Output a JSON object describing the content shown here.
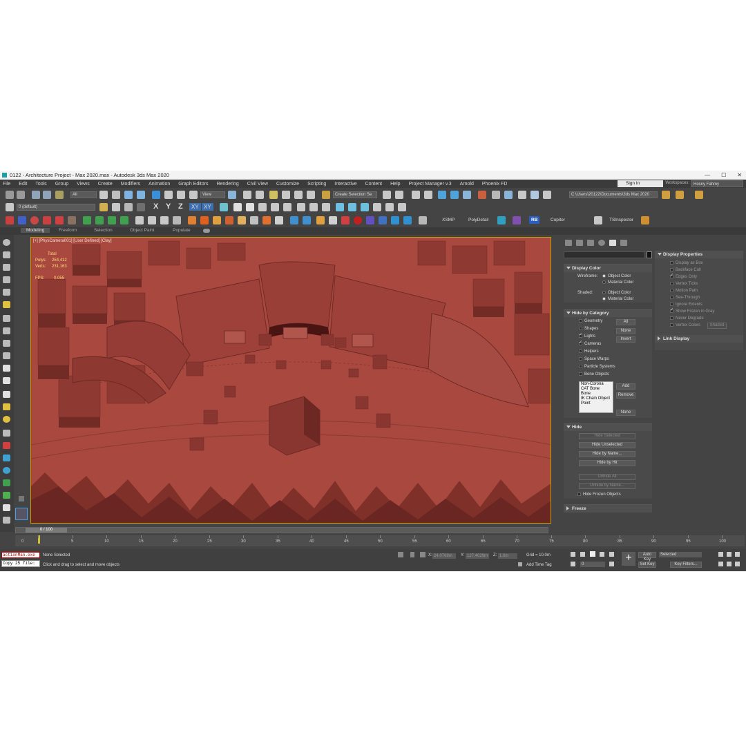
{
  "window": {
    "title": "0122 - Architecture Project - Max 2020.max - Autodesk 3ds Max 2020",
    "minimize": "—",
    "maximize": "☐",
    "close": "✕"
  },
  "menu": [
    "File",
    "Edit",
    "Tools",
    "Group",
    "Views",
    "Create",
    "Modifiers",
    "Animation",
    "Graph Editors",
    "Rendering",
    "Civil View",
    "Customize",
    "Scripting",
    "Interactive",
    "Content",
    "Help",
    "Project Manager v.3",
    "Arnold",
    "Phoenix FD"
  ],
  "account": {
    "sign_in": "Sign In",
    "workspaces_label": "Workspaces:",
    "workspace_value": "Hosny Fahmy"
  },
  "toolbar": {
    "filter_value": "All",
    "view_value": "View",
    "selection_set_placeholder": "Create Selection Se",
    "project_path": "C:\\Users\\20122\\Documents\\3ds Max 2020",
    "layer_value": "0 (default)",
    "axis_x": "X",
    "axis_y": "Y",
    "axis_z": "Z",
    "axis_xy": "XY",
    "axis_xy2": "XY",
    "plugins": [
      "XSMP",
      "PolyDetail",
      "RB",
      "Copitor",
      "TSInspector"
    ]
  },
  "ribbon": {
    "tabs": [
      "Modeling",
      "Freeform",
      "Selection",
      "Object Paint",
      "Populate"
    ]
  },
  "viewport": {
    "label": "[+] [PhysCamera001] [User Defined] [Clay]",
    "stats_total": "Total",
    "stats_polys_label": "Polys:",
    "stats_polys": "254,412",
    "stats_verts_label": "Verts:",
    "stats_verts": "231,163",
    "stats_fps_label": "FPS:",
    "stats_fps": "0.055"
  },
  "command_panel": {
    "display_color": {
      "title": "Display Color",
      "wireframe_label": "Wireframe:",
      "wire_object": "Object Color",
      "wire_material": "Material Color",
      "shaded_label": "Shaded:",
      "shaded_object": "Object Color",
      "shaded_material": "Material Color"
    },
    "hide_by_category": {
      "title": "Hide by Category",
      "items": [
        "Geometry",
        "Shapes",
        "Lights",
        "Cameras",
        "Helpers",
        "Space Warps",
        "Particle Systems",
        "Bone Objects"
      ],
      "btn_all": "All",
      "btn_none": "None",
      "btn_invert": "Invert",
      "list": [
        "Non-Corona",
        "CAT Bone",
        "Bone",
        "IK Chain Object",
        "Point"
      ],
      "btn_add": "Add",
      "btn_remove": "Remove",
      "btn_none2": "None"
    },
    "hide": {
      "title": "Hide",
      "hide_selected": "Hide Selected",
      "hide_unselected": "Hide Unselected",
      "hide_by_name": "Hide by Name...",
      "hide_by_hit": "Hide by Hit",
      "unhide_all": "Unhide All",
      "unhide_by_name": "Unhide by Name...",
      "hide_frozen": "Hide Frozen Objects"
    },
    "freeze": {
      "title": "Freeze"
    }
  },
  "display_properties": {
    "title": "Display Properties",
    "items": [
      "Display as Box",
      "Backface Cull",
      "Edges Only",
      "Vertex Ticks",
      "Motion Path",
      "See-Through",
      "Ignore Extents",
      "Show Frozen in Gray",
      "Never Degrade",
      "Vertex Colors"
    ],
    "shaded_btn": "Shaded",
    "link_display": "Link Display"
  },
  "timeline": {
    "frame": "0 / 100",
    "ticks": [
      "0",
      "5",
      "10",
      "15",
      "20",
      "25",
      "30",
      "35",
      "40",
      "45",
      "50",
      "55",
      "60",
      "65",
      "70",
      "75",
      "80",
      "85",
      "90",
      "95",
      "100"
    ]
  },
  "status": {
    "maxscript_line1": "actionMan.exe",
    "maxscript_line2": "Copy 25 file:",
    "selection": "None Selected",
    "prompt": "Click and drag to select and move objects",
    "x_label": "X:",
    "x_value": "24.0768m",
    "y_label": "Y:",
    "y_value": "127.4029m",
    "z_label": "Z:",
    "z_value": "1.0m",
    "grid": "Grid = 10.0m",
    "add_time_tag": "Add Time Tag",
    "auto_key": "Auto Key",
    "set_key": "Set Key",
    "key_mode": "Selected",
    "key_filters": "Key Filters...",
    "frame_value": "0"
  }
}
